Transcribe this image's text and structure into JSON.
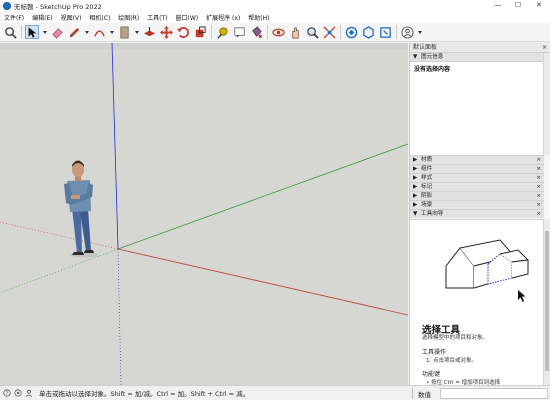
{
  "window": {
    "title": "无标题 - SketchUp Pro 2022",
    "minimize": "—",
    "maximize": "☐",
    "close": "✕"
  },
  "menu": [
    "文件(F)",
    "编辑(E)",
    "视图(V)",
    "相机(C)",
    "绘图(R)",
    "工具(T)",
    "窗口(W)",
    "扩展程序 (x)",
    "帮助(H)"
  ],
  "toolbar": {
    "icons": [
      "search-icon",
      "select-arrow-icon",
      "eraser-icon",
      "pencil-icon",
      "arc-icon",
      "rectangle-icon",
      "push-pull-icon",
      "move-icon",
      "rotate-icon",
      "scale-icon",
      "tape-measure-icon",
      "text-icon",
      "paint-bucket-icon",
      "orbit-icon",
      "pan-icon",
      "zoom-icon",
      "zoom-extents-icon",
      "warehouse-icon",
      "extension-warehouse-icon",
      "layout-icon",
      "account-icon"
    ]
  },
  "tray": {
    "title": "默认面板",
    "close": "×",
    "entity_info": {
      "label": "图元信息",
      "body": "没有选择内容"
    },
    "panels": [
      "材质",
      "组件",
      "样式",
      "标记",
      "阴影",
      "场景",
      "工具向导"
    ],
    "instructor": {
      "title": "选择工具",
      "subtitle": "选择模型中的项目和对象。",
      "operation_heading": "工具操作",
      "operation_1": "1. 点击项目或对象。",
      "keys_heading": "功能键",
      "keys_1": "• 按住 Ctrl = 增加项目到选择"
    }
  },
  "status": {
    "hint": "单击或拖动以选择对象。Shift = 加/减。Ctrl = 加。Shift + Ctrl = 减。",
    "measure_label": "数值",
    "measure_value": ""
  },
  "colors": {
    "viewport_bg": "#d6d6d2",
    "axis_red": "#c0392b",
    "axis_green": "#2e9a2e",
    "axis_blue": "#2b2bd4"
  }
}
